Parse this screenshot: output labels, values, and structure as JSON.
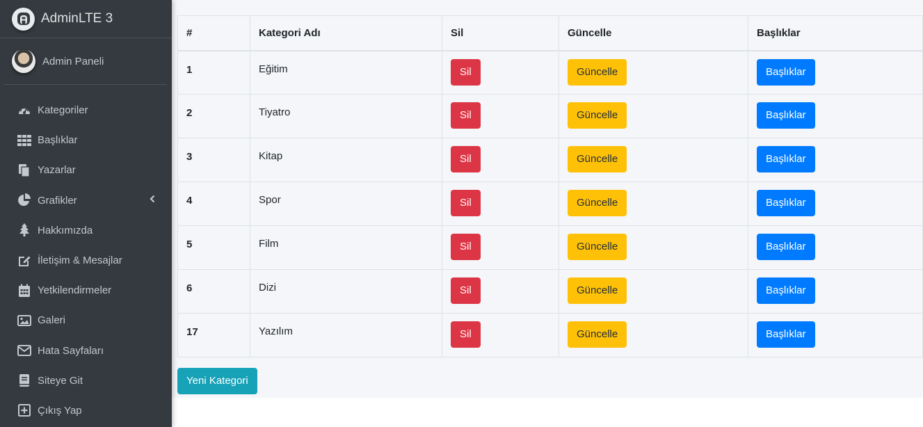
{
  "brand": {
    "title": "AdminLTE 3"
  },
  "user": {
    "name": "Admin Paneli"
  },
  "sidebar": {
    "items": [
      {
        "label": "Kategoriler",
        "icon": "tachometer-icon"
      },
      {
        "label": "Başlıklar",
        "icon": "grid-icon"
      },
      {
        "label": "Yazarlar",
        "icon": "copy-icon"
      },
      {
        "label": "Grafikler",
        "icon": "pie-chart-icon"
      },
      {
        "label": "Hakkımızda",
        "icon": "tree-icon"
      },
      {
        "label": "İletişim & Mesajlar",
        "icon": "edit-icon"
      },
      {
        "label": "Yetkilendirmeler",
        "icon": "calendar-icon"
      },
      {
        "label": "Galeri",
        "icon": "image-icon"
      },
      {
        "label": "Hata Sayfaları",
        "icon": "envelope-icon"
      },
      {
        "label": "Siteye Git",
        "icon": "book-icon"
      },
      {
        "label": "Çıkış Yap",
        "icon": "plus-square-icon"
      }
    ]
  },
  "table": {
    "headers": [
      "#",
      "Kategori Adı",
      "Sil",
      "Güncelle",
      "Başlıklar"
    ],
    "rows": [
      {
        "id": "1",
        "name": "Eğitim",
        "delete": "Sil",
        "update": "Güncelle",
        "titles": "Başlıklar"
      },
      {
        "id": "2",
        "name": "Tiyatro",
        "delete": "Sil",
        "update": "Güncelle",
        "titles": "Başlıklar"
      },
      {
        "id": "3",
        "name": "Kitap",
        "delete": "Sil",
        "update": "Güncelle",
        "titles": "Başlıklar"
      },
      {
        "id": "4",
        "name": "Spor",
        "delete": "Sil",
        "update": "Güncelle",
        "titles": "Başlıklar"
      },
      {
        "id": "5",
        "name": "Film",
        "delete": "Sil",
        "update": "Güncelle",
        "titles": "Başlıklar"
      },
      {
        "id": "6",
        "name": "Dizi",
        "delete": "Sil",
        "update": "Güncelle",
        "titles": "Başlıklar"
      },
      {
        "id": "17",
        "name": "Yazılım",
        "delete": "Sil",
        "update": "Güncelle",
        "titles": "Başlıklar"
      }
    ]
  },
  "actions": {
    "new_category": "Yeni Kategori"
  },
  "colors": {
    "sidebar": "#343a40",
    "danger": "#dc3545",
    "warning": "#ffc107",
    "primary": "#007bff",
    "info": "#17a2b8"
  }
}
